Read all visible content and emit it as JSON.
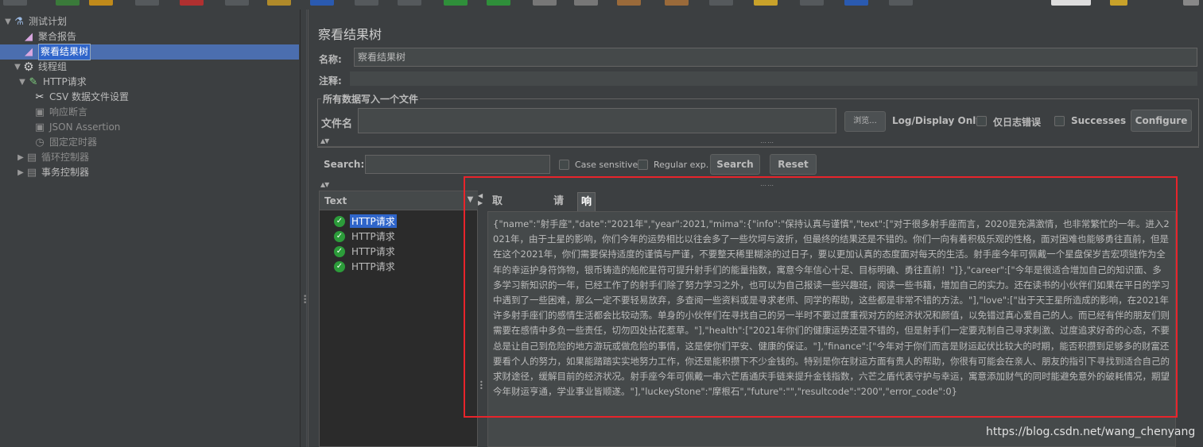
{
  "tree": {
    "items": [
      {
        "label": "测试计划",
        "icon": "flask-icon",
        "toggle": "▼"
      },
      {
        "label": "聚合报告",
        "icon": "report-icon",
        "toggle": ""
      },
      {
        "label": "察看结果树",
        "icon": "report-icon",
        "toggle": ""
      },
      {
        "label": "线程组",
        "icon": "gear-icon",
        "toggle": "▼"
      },
      {
        "label": "HTTP请求",
        "icon": "pipette-icon",
        "toggle": "▼"
      },
      {
        "label": "CSV 数据文件设置",
        "icon": "wrench-icon",
        "toggle": ""
      },
      {
        "label": "响应断言",
        "icon": "assertion-icon",
        "toggle": ""
      },
      {
        "label": "JSON Assertion",
        "icon": "assertion-icon",
        "toggle": ""
      },
      {
        "label": "固定定时器",
        "icon": "timer-icon",
        "toggle": ""
      },
      {
        "label": "循环控制器",
        "icon": "controller-icon",
        "toggle": "▶"
      },
      {
        "label": "事务控制器",
        "icon": "controller-icon",
        "toggle": "▶"
      }
    ]
  },
  "panel": {
    "title": "察看结果树",
    "name_label": "名称:",
    "name_value": "察看结果树",
    "comment_label": "注释:",
    "file_group_title": "所有数据写入一个文件",
    "filename_label": "文件名",
    "browse_button": "浏览...",
    "log_display_label": "Log/Display Only:",
    "errors_only_label": "仅日志错误",
    "successes_label": "Successes",
    "configure_button": "Configure"
  },
  "search": {
    "label": "Search:",
    "case_sensitive_label": "Case sensitive",
    "regular_exp_label": "Regular exp.",
    "search_button": "Search",
    "reset_button": "Reset"
  },
  "results": {
    "renderer": "Text",
    "samples": [
      "HTTP请求",
      "HTTP请求",
      "HTTP请求",
      "HTTP请求"
    ]
  },
  "tabs": [
    "取样器结果",
    "请求",
    "响应数据"
  ],
  "response_text": "{\"name\":\"射手座\",\"date\":\"2021年\",\"year\":2021,\"mima\":{\"info\":\"保持认真与谨慎\",\"text\":[\"对于很多射手座而言，2020是充满激情，也非常繁忙的一年。进入2021年，由于土星的影响，你们今年的运势相比以往会多了一些坎坷与波折，但最终的结果还是不错的。你们一向有着积极乐观的性格，面对困难也能够勇往直前，但是在这个2021年，你们需要保持适度的谨慎与严谨，不要整天稀里糊涂的过日子，要以更加认真的态度面对每天的生活。射手座今年可佩戴一个星盘保岁吉宏项链作为全年的幸运护身符饰物，银币铸造的船舵星符可提升射手们的能量指数，寓意今年信心十足、目标明确、勇往直前！\"]},\"career\":[\"今年是很适合增加自己的知识面、多多学习新知识的一年，已经工作了的射手们除了努力学习之外，也可以为自己报读一些兴趣班，阅读一些书籍，增加自己的实力。还在读书的小伙伴们如果在平日的学习中遇到了一些困难，那么一定不要轻易放弃，多查阅一些资料或是寻求老师、同学的帮助，这些都是非常不错的方法。\"],\"love\":[\"出于天王星所造成的影响，在2021年许多射手座们的感情生活都会比较动荡。单身的小伙伴们在寻找自己的另一半时不要过度重视对方的经济状况和颜值，以免错过真心爱自己的人。而已经有伴的朋友们则需要在感情中多负一些责任，切勿四处拈花惹草。\"],\"health\":[\"2021年你们的健康运势还是不错的，但是射手们一定要克制自己寻求刺激、过度追求好奇的心态，不要总是让自己到危险的地方游玩或做危险的事情，这是使你们平安、健康的保证。\"],\"finance\":[\"今年对于你们而言是财运起伏比较大的时期，能否积攒到足够多的财富还要看个人的努力，如果能踏踏实实地努力工作，你还是能积攒下不少金钱的。特别是你在财运方面有贵人的帮助，你很有可能会在亲人、朋友的指引下寻找到适合自己的求财途径，缓解目前的经济状况。射手座今年可佩戴一串六芒盾通庆手链来提升金钱指数，六芒之盾代表守护与幸运，寓意添加财气的同时能避免意外的破耗情况，期望今年财运亨通，学业事业皆顺遂。\"],\"luckeyStone\":\"摩根石\",\"future\":\"\",\"resultcode\":\"200\",\"error_code\":0}",
  "watermark": "https://blog.csdn.net/wang_chenyang",
  "colors": {
    "background": "#3c3f41",
    "selection": "#2f65ca",
    "highlight_box": "#e8242b",
    "success_icon": "#2c9c3a"
  }
}
